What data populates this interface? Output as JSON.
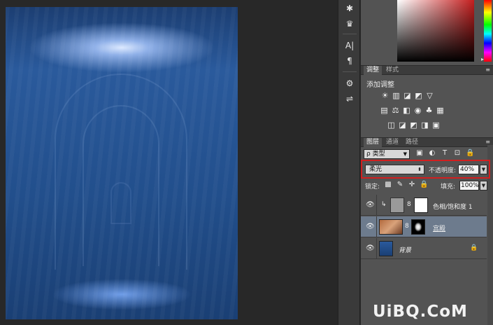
{
  "color_panel": {
    "grip_icon": "▸"
  },
  "adjustments_panel": {
    "tabs": [
      {
        "label": "调整"
      },
      {
        "label": "样式"
      }
    ],
    "menu_icon": "≡",
    "title": "添加调整",
    "rows": [
      [
        "☀",
        "▥",
        "◪",
        "◩",
        "▽"
      ],
      [
        "▤",
        "⚖",
        "◧",
        "◉",
        "♣",
        "▦"
      ],
      [
        "◫",
        "◪",
        "◩",
        "◨",
        "▣"
      ]
    ]
  },
  "layers_panel": {
    "tabs": [
      {
        "label": "图层"
      },
      {
        "label": "通道"
      },
      {
        "label": "路径"
      }
    ],
    "menu_icon": "≡",
    "filter": {
      "label": "ρ 类型",
      "arrow": "▼"
    },
    "filter_icons": [
      "▣",
      "◐",
      "T",
      "⊡",
      "🔒"
    ],
    "blend_mode": {
      "value": "柔光",
      "arrow": "⬍"
    },
    "opacity": {
      "label": "不透明度:",
      "value": "40%",
      "arrow": "▼"
    },
    "lock": {
      "label": "锁定:",
      "icons": [
        "▩",
        "✎",
        "✛",
        "🔒"
      ]
    },
    "fill": {
      "label": "填充:",
      "value": "100%",
      "arrow": "▼"
    },
    "layers": [
      {
        "name": "色相/饱和度 1",
        "eye": "👁",
        "clip": "↳",
        "chain": "8",
        "selected": false
      },
      {
        "name": "宫殿",
        "eye": "👁",
        "chain": "8",
        "selected": true
      },
      {
        "name": "背景",
        "eye": "👁",
        "lock": "🔒",
        "selected": false
      }
    ]
  },
  "toolbar": {
    "icons": [
      "✱",
      "♛",
      "A|",
      "¶",
      "⚙",
      "⇌"
    ]
  },
  "watermark": "UiBQ.CoM",
  "colors": {
    "highlight": "#d21f1f",
    "selected_layer": "#6d7b8d",
    "panel_bg": "#535353"
  }
}
